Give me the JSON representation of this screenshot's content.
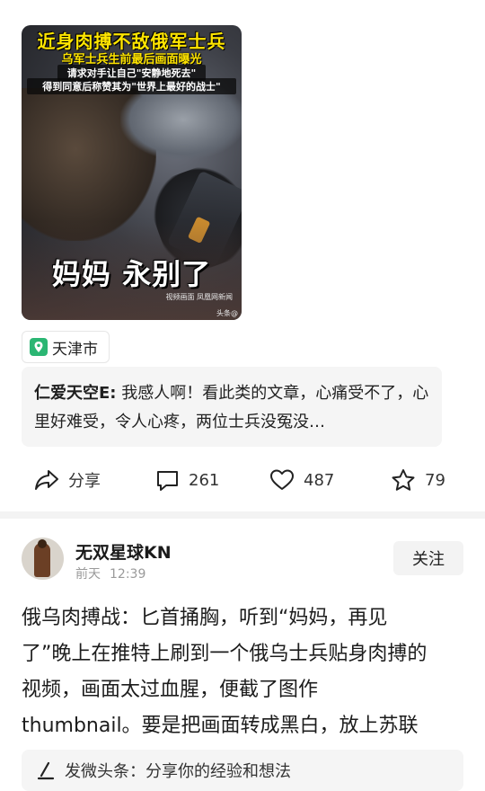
{
  "post1": {
    "thumbnail": {
      "headline": "近身肉搏不敌俄军士兵",
      "subheadline": "乌军士兵生前最后画面曝光",
      "note_line1": "请求对手让自己\"安静地死去\"",
      "note_line2": "得到同意后称赞其为\"世界上最好的战士\"",
      "caption": "妈妈 永别了",
      "watermark_source": "视频画面 凤凰网新闻",
      "watermark_platform": "头条@"
    },
    "location": "天津市",
    "comment": {
      "author": "仁爱天空E:",
      "text": "我感人啊！看此类的文章，心痛受不了，心里好难受，令人心疼，两位士兵没冤没…"
    },
    "actions": {
      "share_label": "分享",
      "comment_count": "261",
      "like_count": "487",
      "favorite_count": "79"
    }
  },
  "post2": {
    "username": "无双星球KN",
    "date": "前天",
    "time": "12:39",
    "follow_label": "关注",
    "body_lines": [
      "俄乌肉搏战：匕首捅胸，听到“妈妈，再见",
      "了”晚上在推特上刷到一个俄乌士兵贴身肉搏的",
      "视频，画面太过血腥，便截了图作",
      "thumbnail。要是把画面转成黑白，放上苏联"
    ]
  },
  "composer": {
    "placeholder": "发微头条：分享你的经验和想法"
  },
  "colors": {
    "headline_yellow": "#ffe500",
    "location_icon_green": "#2bb673",
    "panel_gray": "#f5f5f5"
  },
  "icons": [
    "location-pin-icon",
    "share-icon",
    "comment-icon",
    "heart-icon",
    "star-icon",
    "pen-icon"
  ]
}
